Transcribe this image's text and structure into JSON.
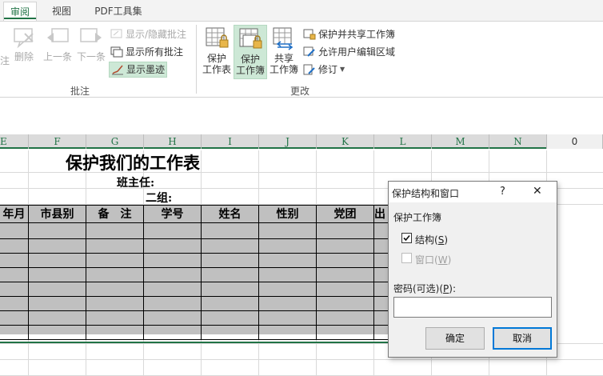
{
  "tabs": [
    {
      "label": "审阅",
      "active": true
    },
    {
      "label": "视图",
      "active": false
    },
    {
      "label": "PDF工具集",
      "active": false
    }
  ],
  "ribbon": {
    "annotation_group": {
      "label": "批注",
      "partial_new": "注",
      "delete": "删除",
      "previous": "上一条",
      "next": "下一条",
      "show_hide": "显示/隐藏批注",
      "show_all": "显示所有批注",
      "show_ink": "显示墨迹"
    },
    "changes_group": {
      "label": "更改",
      "protect_sheet": [
        "保护",
        "工作表"
      ],
      "protect_workbook": [
        "保护",
        "工作簿"
      ],
      "share_workbook": [
        "共享",
        "工作簿"
      ],
      "protect_share": "保护并共享工作簿",
      "allow_edit": "允许用户编辑区域",
      "track": "修订"
    }
  },
  "sheet": {
    "columns": [
      "E",
      "F",
      "G",
      "H",
      "I",
      "J",
      "K",
      "L",
      "M",
      "N",
      "0"
    ],
    "title": "保护我们的工作表",
    "teacher_label": "班主任:",
    "group_label": "二组:",
    "headers": [
      "年月",
      "市县别",
      "备　注",
      "学号",
      "姓名",
      "性别",
      "党团",
      "出"
    ]
  },
  "dialog": {
    "title": "保护结构和窗口",
    "help": "?",
    "close": "✕",
    "section": "保护工作簿",
    "structure": {
      "label": "结构",
      "hotkey": "S",
      "checked": true
    },
    "windows": {
      "label": "窗口",
      "hotkey": "W",
      "checked": false,
      "disabled": true
    },
    "password_label_pre": "密码(可选)(",
    "password_hotkey": "P",
    "password_label_post": "):",
    "password_value": "",
    "ok": "确定",
    "cancel": "取消"
  },
  "colors": {
    "accent": "#217346",
    "selection": "#c0c0c0",
    "focus": "#0078d7"
  }
}
